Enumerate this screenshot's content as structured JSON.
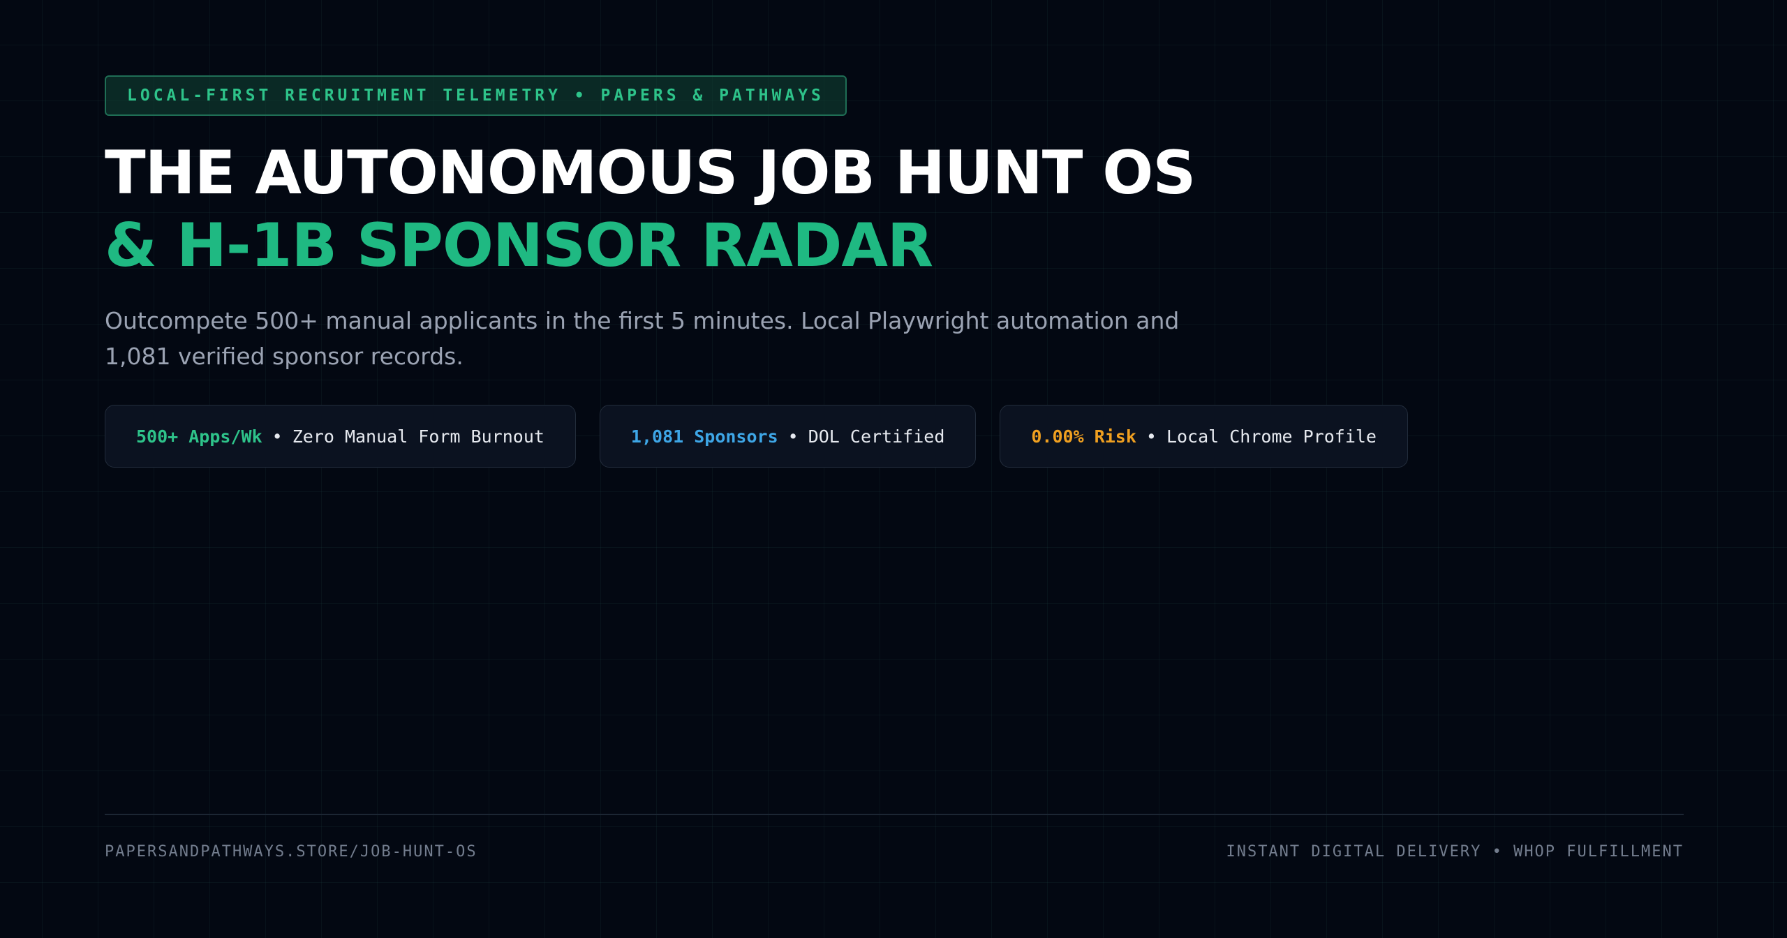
{
  "kicker": "LOCAL-FIRST RECRUITMENT TELEMETRY • PAPERS & PATHWAYS",
  "headline": {
    "line1": "THE AUTONOMOUS JOB HUNT OS",
    "line2": "& H-1B SPONSOR RADAR"
  },
  "subtitle": "Outcompete 500+ manual applicants in the first 5 minutes. Local Playwright automation and 1,081 verified sponsor records.",
  "stats": [
    {
      "highlight": "500+ Apps/Wk",
      "separator": "•",
      "text": "Zero Manual Form Burnout",
      "color": "#2ec38a"
    },
    {
      "highlight": "1,081 Sponsors",
      "separator": "•",
      "text": "DOL Certified",
      "color": "#3ea6e6"
    },
    {
      "highlight": "0.00% Risk",
      "separator": "•",
      "text": "Local Chrome Profile",
      "color": "#f0a020"
    }
  ],
  "footer": {
    "url": "PAPERSANDPATHWAYS.STORE/JOB-HUNT-OS",
    "delivery": "INSTANT DIGITAL DELIVERY • WHOP FULFILLMENT"
  },
  "colors": {
    "background": "#030812",
    "accent": "#1fb982"
  }
}
